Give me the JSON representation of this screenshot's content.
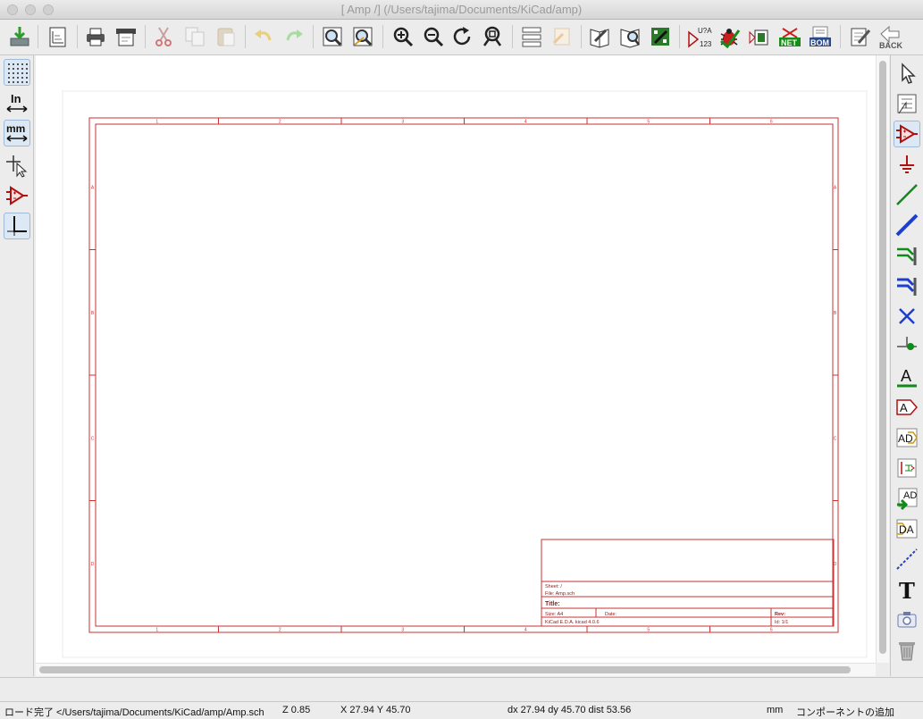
{
  "window": {
    "title": "[ Amp /] (/Users/tajima/Documents/KiCad/amp)"
  },
  "toolbar_icons": [
    "save-icon",
    "page-settings-icon",
    "print-icon",
    "plot-icon",
    "cut-icon",
    "copy-icon",
    "paste-icon",
    "undo-icon",
    "redo-icon",
    "search-icon",
    "find-replace-icon",
    "zoom-in-icon",
    "zoom-out-icon",
    "redraw-icon",
    "zoom-fit-icon",
    "hierarchy-navigator-icon",
    "leave-sheet-icon",
    "library-editor-icon",
    "library-browser-icon",
    "pcb-icon",
    "annotate-icon",
    "erc-icon",
    "footprint-assign-icon",
    "netlist-icon",
    "bom-icon",
    "import-footprint-icon",
    "back-icon"
  ],
  "toolbar": {
    "annotate_text": "U?A",
    "annotate_sub": "123",
    "net_label": "NET",
    "bom_label": "BOM",
    "back_label": "BACK"
  },
  "left_toolbar": {
    "inch_label": "In",
    "mm_label": "mm"
  },
  "right_toolbar": {
    "text_tool_glyph": "T",
    "label_glyph": "A",
    "global_label_glyph": "A",
    "hier_label_glyph": "AD",
    "import_pin_glyph": "AD",
    "sheet_pin_glyph": "DA"
  },
  "sheet": {
    "col_labels": [
      "1",
      "2",
      "3",
      "4",
      "5",
      "6"
    ],
    "row_labels": [
      "A",
      "B",
      "C",
      "D"
    ],
    "title_block": {
      "sheet_line": "Sheet: /",
      "file_line": "File: Amp.sch",
      "title_line": "Title:",
      "size_line": "Size: A4",
      "date_line": "Date:",
      "rev_line": "Rev:",
      "kicad_line": "KiCad E.D.A.  kicad 4.0.6",
      "id_line": "Id: 1/1"
    }
  },
  "status": {
    "message": "ロード完了 </Users/tajima/Documents/KiCad/amp/Amp.sch",
    "zoom": "Z 0.85",
    "xy": "X 27.94  Y 45.70",
    "delta": "dx 27.94  dy 45.70  dist 53.56",
    "units": "mm",
    "mode": "コンポーネントの追加"
  },
  "colors": {
    "sheet_border": "#c83232",
    "accent_red": "#b01010",
    "wire_green": "#118a1a",
    "bus_blue": "#1e3fc8",
    "title_text": "#8b1a1a"
  }
}
